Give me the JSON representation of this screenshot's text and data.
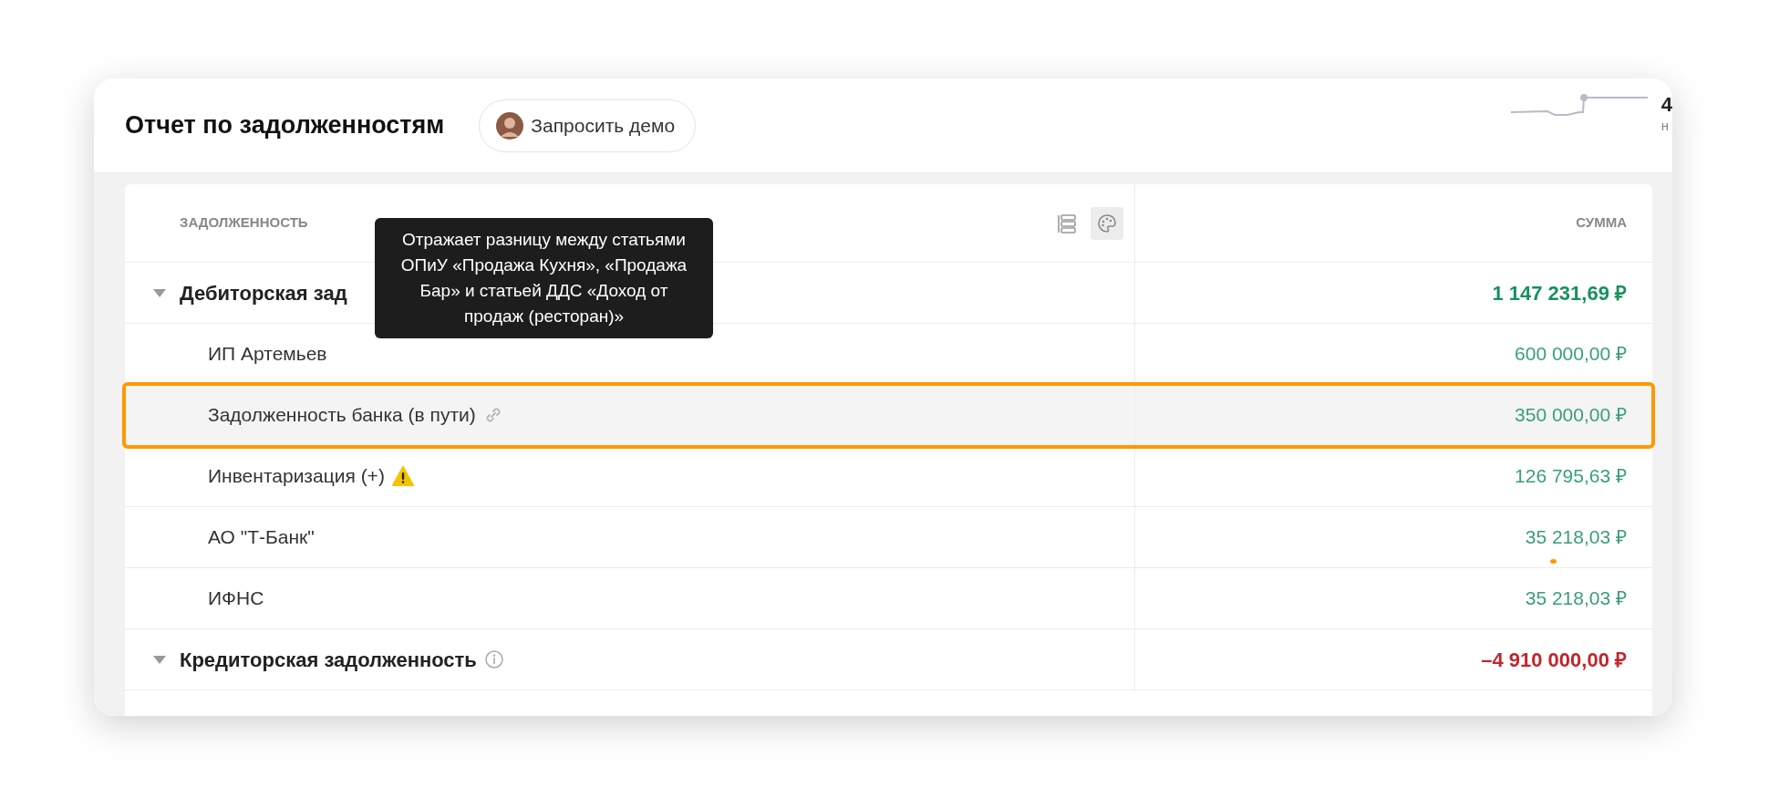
{
  "header": {
    "title": "Отчет по задолженностям",
    "demo_button": "Запросить демо",
    "stat_value": "4",
    "stat_caption": "н"
  },
  "table": {
    "columns": [
      "ЗАДОЛЖЕННОСТЬ",
      "СУММА"
    ],
    "tools": [
      {
        "kind": "layout",
        "selected": false
      },
      {
        "kind": "palette",
        "selected": true
      }
    ],
    "rows": [
      {
        "kind": "group",
        "name": "Дебиторская зад",
        "amount": "1 147 231,69 ₽",
        "color": "#17905d",
        "expanded": true,
        "selected": false
      },
      {
        "kind": "item",
        "name": "ИП Артемьев",
        "amount": "600 000,00 ₽",
        "color": "#3a9f75",
        "selected": false
      },
      {
        "kind": "linked",
        "name": "Задолженность банка (в пути)",
        "amount": "350 000,00 ₽",
        "color": "#3a9f75",
        "selected": true
      },
      {
        "kind": "flagged",
        "name": "Инвентаризация (+)",
        "amount": "126 795,63 ₽",
        "color": "#3a9f75",
        "selected": false
      },
      {
        "kind": "item",
        "name": "АО \"Т-Банк\"",
        "amount": "35 218,03 ₽",
        "color": "#3a9f75",
        "selected": false
      },
      {
        "kind": "item",
        "name": "ИФНС",
        "amount": "35 218,03 ₽",
        "color": "#3a9f75",
        "selected": false
      },
      {
        "kind": "annotated",
        "name": "Кредиторская задолженность",
        "amount": "–4 910 000,00 ₽",
        "color": "#c0262d",
        "expanded": true,
        "selected": false
      }
    ]
  },
  "tooltip": {
    "text": "Отражает разницу между статьями ОПиУ «Продажа Кухня», «Продажа Бар» и статьей ДДС «Доход от продаж (ресторан)»"
  }
}
